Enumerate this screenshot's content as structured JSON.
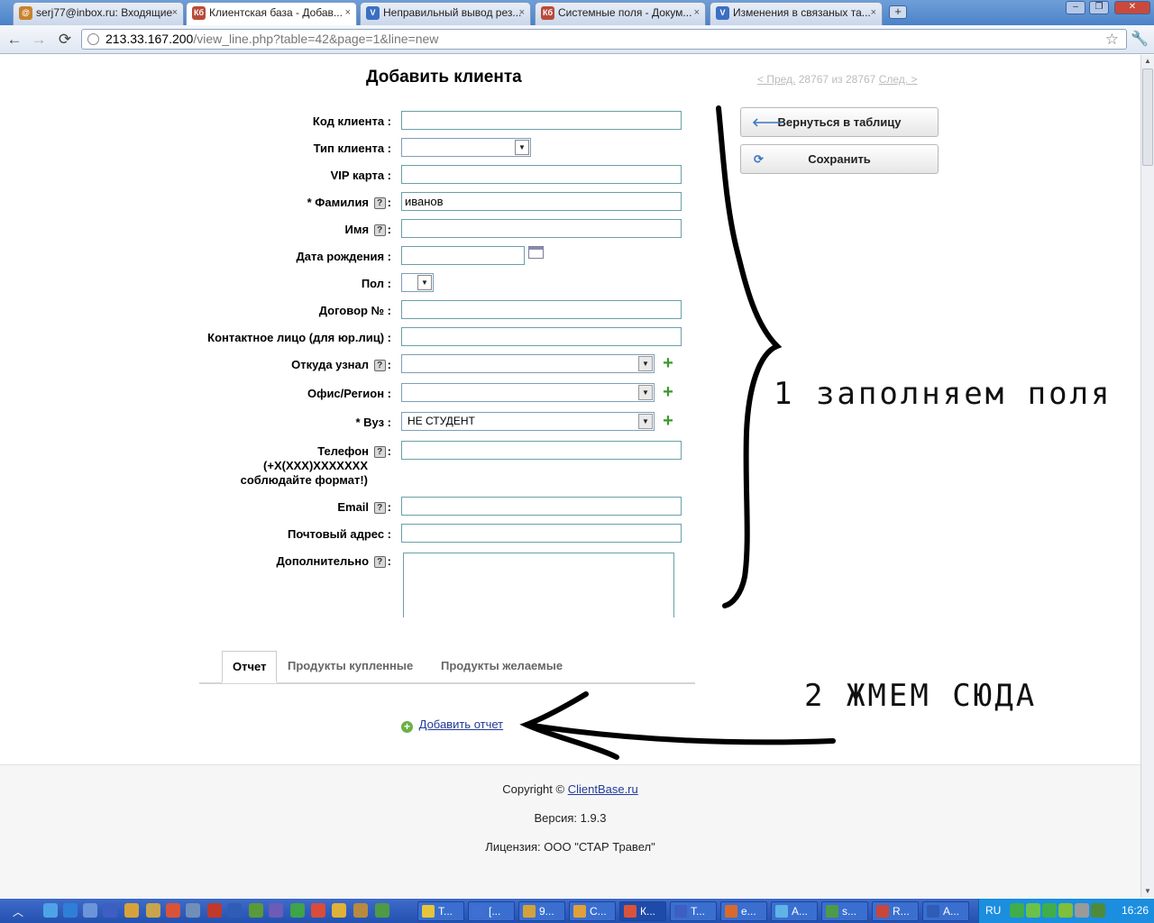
{
  "browser": {
    "tabs": [
      {
        "label": "serj77@inbox.ru: Входящие",
        "favicon_color": "#c9822c"
      },
      {
        "label": "Клиентская база - Добав...",
        "favicon_color": "#b84b3a",
        "favicon_text": "Кб"
      },
      {
        "label": "Неправильный вывод рез...",
        "favicon_color": "#3b6fc2"
      },
      {
        "label": "Системные поля - Докум...",
        "favicon_color": "#b84b3a",
        "favicon_text": "Кб"
      },
      {
        "label": "Изменения в связаных та...",
        "favicon_color": "#3b6fc2"
      }
    ],
    "tab_close_glyph": "×",
    "new_tab_glyph": "+",
    "window_buttons": [
      "‒",
      "❐",
      "✕"
    ],
    "url_host": "213.33.167.200",
    "url_path": "/view_line.php?table=42&page=1&line=new",
    "nav": {
      "back": "←",
      "forward": "→",
      "reload": "⟳",
      "star": "☆",
      "wrench": "🔧"
    }
  },
  "form": {
    "title": "Добавить клиента",
    "pager": {
      "prev": "< Пред.",
      "position": "28767 из 28767",
      "next": "След. >"
    },
    "labels": {
      "client_code": "Код клиента :",
      "client_type": "Тип клиента :",
      "vip_card": "VIP карта :",
      "surname": "* Фамилия",
      "name": "Имя",
      "birth_date": "Дата рождения :",
      "gender": "Пол :",
      "contract": "Договор № :",
      "contact_person": "Контактное лицо (для юр.лиц) :",
      "source": "Откуда узнал",
      "office": "Офис/Регион :",
      "university": "* Вуз :",
      "phone_l1": "Телефон",
      "phone_l2": "(+X(XXX)XXXXXXX",
      "phone_l3": "соблюдайте формат!)",
      "email": "Email",
      "postal": "Почтовый адрес :",
      "extra": "Дополнительно"
    },
    "help_glyph": "?",
    "colon": ":",
    "values": {
      "surname": "иванов",
      "university": "НЕ СТУДЕНТ"
    },
    "dropdown_glyph": "▼",
    "add_glyph": "+"
  },
  "actions": {
    "back_to_table": "Вернуться в таблицу",
    "save": "Сохранить",
    "back_icon": "🡐",
    "save_icon": "⟳"
  },
  "subtabs": {
    "items": [
      "Отчет",
      "Продукты купленные",
      "Продукты желаемые"
    ],
    "add_report": "Добавить отчет",
    "add_icon": "+"
  },
  "footer": {
    "copyright_prefix": "Copyright ©",
    "copyright_link": "ClientBase.ru",
    "version": "Версия: 1.9.3",
    "license": "Лицензия: ООО \"СТАР Травел\""
  },
  "annotations": {
    "step1": "1 заполняем поля",
    "step2": "2 ЖМЕМ СЮДА"
  },
  "taskbar": {
    "up_glyph": "︿",
    "tasks": [
      "Т...",
      "[...",
      "9...",
      "С...",
      "К...",
      "Т...",
      "е...",
      "А...",
      "s...",
      "R...",
      "А..."
    ],
    "lang": "RU",
    "clock": "16:26"
  }
}
